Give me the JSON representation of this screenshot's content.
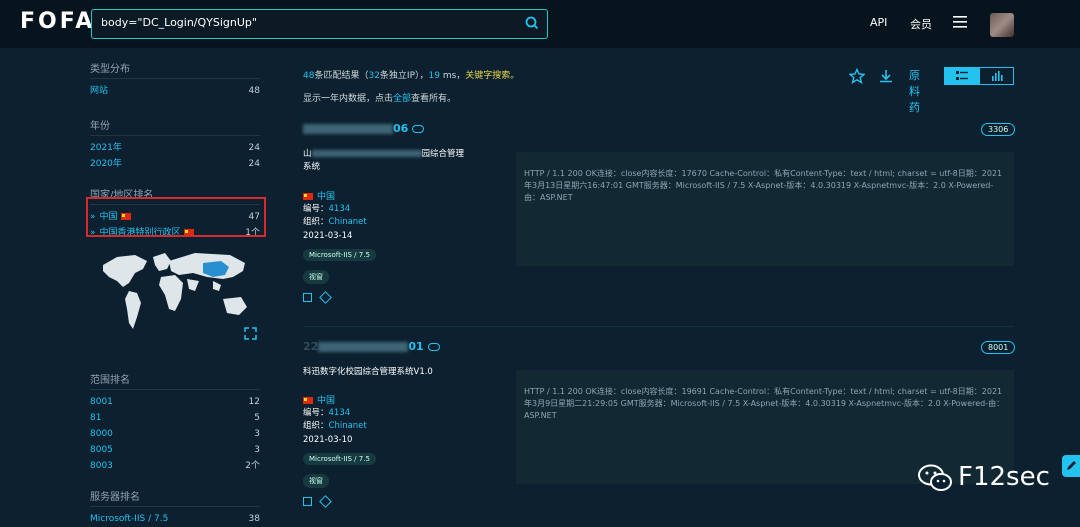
{
  "header": {
    "logo": "FOFA",
    "query": "body=\"DC_Login/QYSignUp\"",
    "api": "API",
    "vip": "会员"
  },
  "sidebar": {
    "type_title": "类型分布",
    "types": [
      {
        "k": "网站",
        "v": "48"
      }
    ],
    "year_title": "年份",
    "years": [
      {
        "k": "2021年",
        "v": "24"
      },
      {
        "k": "2020年",
        "v": "24"
      }
    ],
    "region_title": "国家/地区排名",
    "regions": [
      {
        "k": "中国",
        "v": "47"
      },
      {
        "k": "中国香港特别行政区",
        "v": "1个"
      }
    ],
    "port_title": "范围排名",
    "ports": [
      {
        "k": "8001",
        "v": "12"
      },
      {
        "k": "81",
        "v": "5"
      },
      {
        "k": "8000",
        "v": "3"
      },
      {
        "k": "8005",
        "v": "3"
      },
      {
        "k": "8003",
        "v": "2个"
      }
    ],
    "server_title": "服务器排名",
    "servers": [
      {
        "k": "Microsoft-IIS / 7.5",
        "v": "38"
      }
    ]
  },
  "summary": {
    "count": "48",
    "t1": "条匹配结果（",
    "unique": "32",
    "t2": "条独立IP），",
    "ms": "19",
    "t3": " ms，",
    "kw": "关键字搜索。",
    "note_pre": "显示一年内数据，点击",
    "note_link": "全部",
    "note_post": "查看所有。",
    "raw": "原料药"
  },
  "results": [
    {
      "host_suffix": "06",
      "title_prefix": "山",
      "title_suffix": "园综合管理",
      "title_line2": "系统",
      "country": "中国",
      "asn_label": "编号：",
      "asn": "4134",
      "org_label": "组织：",
      "org": "Chinanet",
      "date": "2021-03-14",
      "tag": "Microsoft-IIS / 7.5",
      "tag2": "视窗",
      "port": "3306",
      "banner": "HTTP / 1.1 200 OK连接：close内容长度：17670 Cache-Control：私有Content-Type：text / html; charset = utf-8日期：2021年3月13日星期六16:47:01 GMT服务器：Microsoft-IIS / 7.5 X-Aspnet-版本：4.0.30319 X-Aspnetmvc-版本：2.0 X-Powered-由：ASP.NET"
    },
    {
      "host_prefix": "22",
      "host_suffix": "01",
      "title": "科迅数字化校园综合管理系统V1.0",
      "country": "中国",
      "asn_label": "编号：",
      "asn": "4134",
      "org_label": "组织：",
      "org": "Chinanet",
      "date": "2021-03-10",
      "tag": "Microsoft-IIS / 7.5",
      "tag2": "视窗",
      "port": "8001",
      "banner": "HTTP / 1.1 200 OK连接：close内容长度：19691 Cache-Control：私有Content-Type：text / html; charset = utf-8日期：2021年3月9日星期二21:29:05 GMT服务器：Microsoft-IIS / 7.5 X-Aspnet-版本：4.0.30319 X-Aspnetmvc-版本：2.0 X-Powered-由：ASP.NET"
    }
  ],
  "watermark": "F12sec"
}
